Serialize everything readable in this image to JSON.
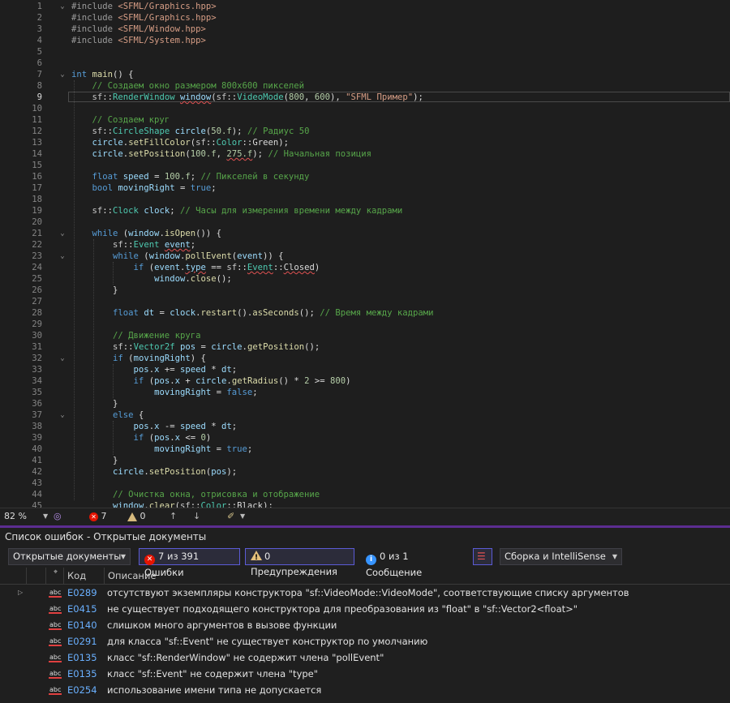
{
  "editor": {
    "lines": [
      {
        "n": "1",
        "html": "<span class='pp'>#include</span> <span class='inc'>&lt;SFML/Graphics.hpp&gt;</span>",
        "fold": "⌄"
      },
      {
        "n": "2",
        "html": "<span class='pp'>#include</span> <span class='inc'>&lt;SFML/Graphics.hpp&gt;</span>"
      },
      {
        "n": "3",
        "html": "<span class='pp'>#include</span> <span class='inc'>&lt;SFML/Window.hpp&gt;</span>"
      },
      {
        "n": "4",
        "html": "<span class='pp'>#include</span> <span class='inc'>&lt;SFML/System.hpp&gt;</span>"
      },
      {
        "n": "5",
        "html": ""
      },
      {
        "n": "6",
        "html": ""
      },
      {
        "n": "7",
        "html": "<span class='kw'>int</span> <span class='fn'>main</span>() {",
        "fold": "⌄"
      },
      {
        "n": "8",
        "html": "    <span class='cm'>// Создаем окно размером 800x600 пикселей</span>"
      },
      {
        "n": "9",
        "html": "    <span class='ns'>sf</span>::<span class='ty'>RenderWindow</span> <span class='vr sq'>window</span>(<span class='ns'>sf</span>::<span class='ty'>VideoMode</span>(<span class='nu'>800</span>, <span class='nu'>600</span>), <span class='st'>\"SFML Пример\"</span>);",
        "cur": true
      },
      {
        "n": "10",
        "html": ""
      },
      {
        "n": "11",
        "html": "    <span class='cm'>// Создаем круг</span>"
      },
      {
        "n": "12",
        "html": "    <span class='ns'>sf</span>::<span class='ty'>CircleShape</span> <span class='vr'>circle</span>(<span class='nu'>50.f</span>); <span class='cm'>// Радиус 50</span>"
      },
      {
        "n": "13",
        "html": "    <span class='vr'>circle</span>.<span class='fn'>setFillColor</span>(<span class='ns'>sf</span>::<span class='ty'>Color</span>::<span class='mb'>Green</span>);"
      },
      {
        "n": "14",
        "html": "    <span class='vr'>circle</span>.<span class='fn'>setPosition</span>(<span class='nu'>100.f</span>, <span class='nu sq'>275.f</span>); <span class='cm'>// Начальная позиция</span>"
      },
      {
        "n": "15",
        "html": ""
      },
      {
        "n": "16",
        "html": "    <span class='kw'>float</span> <span class='vr'>speed</span> = <span class='nu'>100.f</span>; <span class='cm'>// Пикселей в секунду</span>"
      },
      {
        "n": "17",
        "html": "    <span class='kw'>bool</span> <span class='vr'>movingRight</span> = <span class='kw'>true</span>;"
      },
      {
        "n": "18",
        "html": ""
      },
      {
        "n": "19",
        "html": "    <span class='ns'>sf</span>::<span class='ty'>Clock</span> <span class='vr'>clock</span>; <span class='cm'>// Часы для измерения времени между кадрами</span>"
      },
      {
        "n": "20",
        "html": ""
      },
      {
        "n": "21",
        "html": "    <span class='kw'>while</span> (<span class='vr'>window</span>.<span class='fn'>isOpen</span>()) {",
        "fold": "⌄"
      },
      {
        "n": "22",
        "html": "        <span class='ns'>sf</span>::<span class='ty'>Event</span> <span class='vr sq'>event</span>;"
      },
      {
        "n": "23",
        "html": "        <span class='kw'>while</span> (<span class='vr'>window</span>.<span class='fn'>pollEvent</span>(<span class='vr'>event</span>)) {",
        "fold": "⌄"
      },
      {
        "n": "24",
        "html": "            <span class='kw'>if</span> (<span class='vr'>event</span>.<span class='vr sq'>type</span> == <span class='ns'>sf</span>::<span class='ty sq'>Event</span>::<span class='mb sq'>Closed</span>)"
      },
      {
        "n": "25",
        "html": "                <span class='vr'>window</span>.<span class='fn'>close</span>();"
      },
      {
        "n": "26",
        "html": "        }"
      },
      {
        "n": "27",
        "html": ""
      },
      {
        "n": "28",
        "html": "        <span class='kw'>float</span> <span class='vr'>dt</span> = <span class='vr'>clock</span>.<span class='fn'>restart</span>().<span class='fn'>asSeconds</span>(); <span class='cm'>// Время между кадрами</span>"
      },
      {
        "n": "29",
        "html": ""
      },
      {
        "n": "30",
        "html": "        <span class='cm'>// Движение круга</span>"
      },
      {
        "n": "31",
        "html": "        <span class='ns'>sf</span>::<span class='ty'>Vector2f</span> <span class='vr'>pos</span> = <span class='vr'>circle</span>.<span class='fn'>getPosition</span>();"
      },
      {
        "n": "32",
        "html": "        <span class='kw'>if</span> (<span class='vr'>movingRight</span>) {",
        "fold": "⌄"
      },
      {
        "n": "33",
        "html": "            <span class='vr'>pos</span>.<span class='vr'>x</span> += <span class='vr'>speed</span> * <span class='vr'>dt</span>;"
      },
      {
        "n": "34",
        "html": "            <span class='kw'>if</span> (<span class='vr'>pos</span>.<span class='vr'>x</span> + <span class='vr'>circle</span>.<span class='fn'>getRadius</span>() * <span class='nu'>2</span> &gt;= <span class='nu'>800</span>)"
      },
      {
        "n": "35",
        "html": "                <span class='vr'>movingRight</span> = <span class='kw'>false</span>;"
      },
      {
        "n": "36",
        "html": "        }"
      },
      {
        "n": "37",
        "html": "        <span class='kw'>else</span> {",
        "fold": "⌄"
      },
      {
        "n": "38",
        "html": "            <span class='vr'>pos</span>.<span class='vr'>x</span> -= <span class='vr'>speed</span> * <span class='vr'>dt</span>;"
      },
      {
        "n": "39",
        "html": "            <span class='kw'>if</span> (<span class='vr'>pos</span>.<span class='vr'>x</span> &lt;= <span class='nu'>0</span>)"
      },
      {
        "n": "40",
        "html": "                <span class='vr'>movingRight</span> = <span class='kw'>true</span>;"
      },
      {
        "n": "41",
        "html": "        }"
      },
      {
        "n": "42",
        "html": "        <span class='vr'>circle</span>.<span class='fn'>setPosition</span>(<span class='vr'>pos</span>);"
      },
      {
        "n": "43",
        "html": ""
      },
      {
        "n": "44",
        "html": "        <span class='cm'>// Очистка окна, отрисовка и отображение</span>"
      },
      {
        "n": "45",
        "html": "        <span class='vr'>window</span>.<span class='fn'>clear</span>(<span class='ns'>sf</span>::<span class='ty'>Color</span>::<span class='mb'>Black</span>);"
      }
    ]
  },
  "statusbar": {
    "zoom": "82 %",
    "errors": "7",
    "warnings": "0"
  },
  "panel": {
    "title": "Список ошибок - Открытые документы",
    "scope": "Открытые документы",
    "errors_filter": "7 из 391 Ошибки",
    "warnings_filter": "0 Предупреждения",
    "messages_filter": "0 из 1 Сообщение",
    "source": "Сборка и IntelliSense",
    "col_code": "Код",
    "col_desc": "Описание",
    "severity_tag": "abc",
    "rows": [
      {
        "code": "E0289",
        "desc": "отсутствуют экземпляры конструктора \"sf::VideoMode::VideoMode\", соответствующие списку аргументов"
      },
      {
        "code": "E0415",
        "desc": "не существует подходящего конструктора для преобразования из \"float\" в \"sf::Vector2<float>\""
      },
      {
        "code": "E0140",
        "desc": "слишком много аргументов в вызове функции"
      },
      {
        "code": "E0291",
        "desc": "для класса \"sf::Event\" не существует конструктор по умолчанию"
      },
      {
        "code": "E0135",
        "desc": "класс \"sf::RenderWindow\" не содержит члена \"pollEvent\""
      },
      {
        "code": "E0135",
        "desc": "класс \"sf::Event\" не содержит члена \"type\""
      },
      {
        "code": "E0254",
        "desc": "использование имени типа не допускается"
      }
    ]
  }
}
